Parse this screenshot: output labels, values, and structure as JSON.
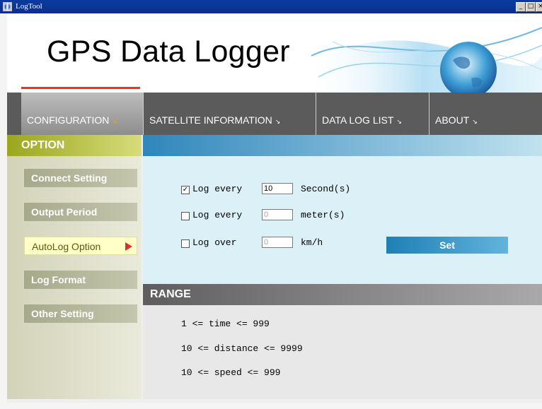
{
  "window": {
    "title": "LogTool",
    "controls": [
      "_",
      "□",
      "×"
    ]
  },
  "header": {
    "title": "GPS Data Logger"
  },
  "nav": {
    "tabs": [
      {
        "label": "CONFIGURATION",
        "chevron": "↘",
        "active": true
      },
      {
        "label": "SATELLITE INFORMATION",
        "chevron": "↘",
        "active": false
      },
      {
        "label": "DATA LOG LIST",
        "chevron": "↘",
        "active": false
      },
      {
        "label": "ABOUT",
        "chevron": "↘",
        "active": false
      }
    ]
  },
  "sidebar": {
    "header": "OPTION",
    "items": [
      {
        "label": "Connect Setting",
        "active": false
      },
      {
        "label": "Output Period",
        "active": false
      },
      {
        "label": "AutoLog Option",
        "active": true
      },
      {
        "label": "Log Format",
        "active": false
      },
      {
        "label": "Other Setting",
        "active": false
      }
    ]
  },
  "options": {
    "rows": [
      {
        "checked": true,
        "check_mark": "✓",
        "prefix": "Log every",
        "value": "10",
        "unit": "Second(s)"
      },
      {
        "checked": false,
        "check_mark": "",
        "prefix": "Log every",
        "value": "0",
        "unit": "meter(s)"
      },
      {
        "checked": false,
        "check_mark": "",
        "prefix": "Log over",
        "value": "0",
        "unit": "km/h"
      }
    ],
    "set_label": "Set"
  },
  "range": {
    "header": "RANGE",
    "lines": [
      "1 <= time <= 999",
      "10 <= distance <= 9999",
      "10 <= speed <= 999"
    ]
  },
  "colors": {
    "accent_red": "#e23a1f",
    "option_green": "#9ba61e",
    "set_blue": "#1f7fb4",
    "arrow_red": "#d8322a"
  }
}
